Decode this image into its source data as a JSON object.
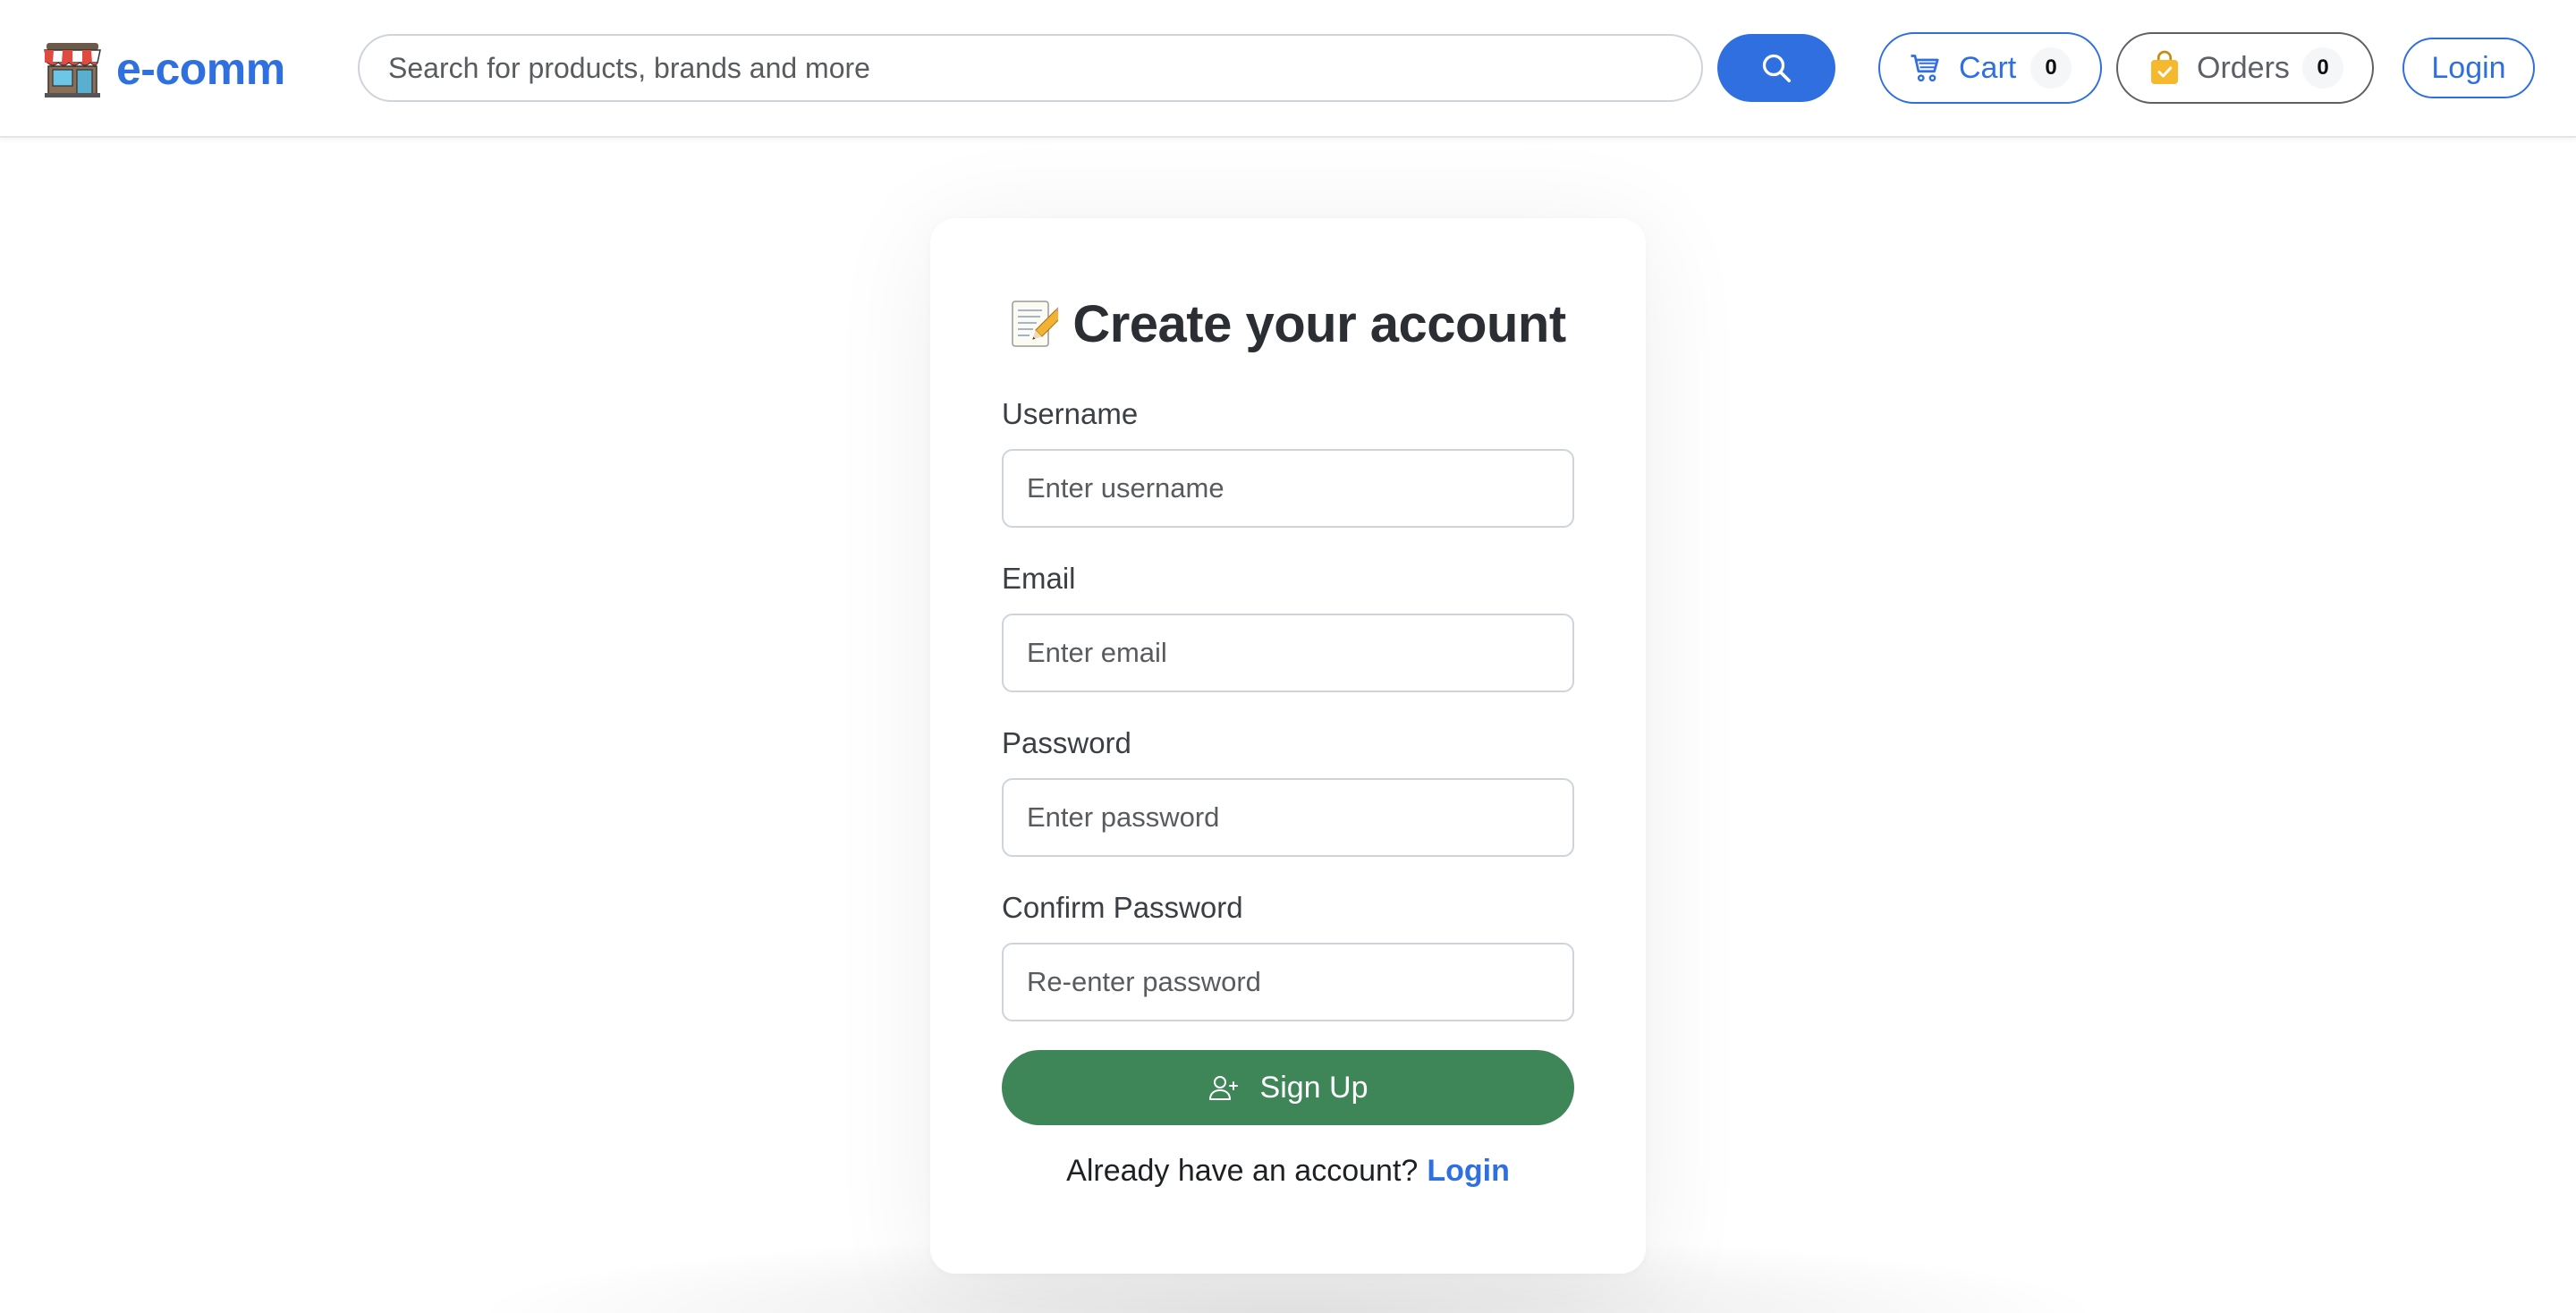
{
  "header": {
    "brand": "e-comm",
    "search_placeholder": "Search for products, brands and more",
    "cart_label": "Cart",
    "cart_count": "0",
    "orders_label": "Orders",
    "orders_count": "0",
    "login_label": "Login"
  },
  "signup": {
    "title": "Create your account",
    "fields": [
      {
        "label": "Username",
        "placeholder": "Enter username",
        "value": ""
      },
      {
        "label": "Email",
        "placeholder": "Enter email",
        "value": ""
      },
      {
        "label": "Password",
        "placeholder": "Enter password",
        "value": ""
      },
      {
        "label": "Confirm Password",
        "placeholder": "Re-enter password",
        "value": ""
      }
    ],
    "submit_label": "Sign Up",
    "already_text": "Already have an account?",
    "login_link": "Login"
  },
  "icons": {
    "brand": "storefront-icon",
    "search": "search-icon",
    "cart": "cart-icon",
    "orders": "shopping-bag-icon",
    "title": "memo-icon",
    "submit": "add-user-icon"
  },
  "colors": {
    "primary": "#2f6fe0",
    "success": "#3e8558",
    "orders_bag": "#f5b82e",
    "muted": "#5d6166"
  }
}
